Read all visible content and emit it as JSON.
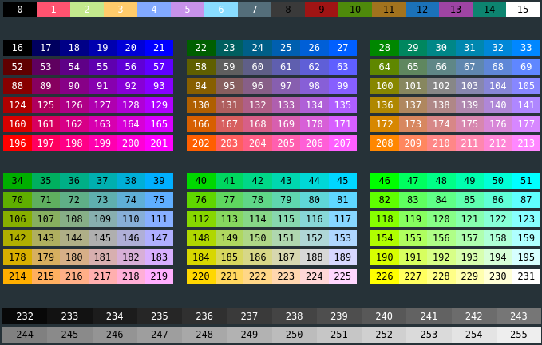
{
  "palette": {
    "base16": [
      {
        "label": "0",
        "bg": "#000000",
        "fg": "#ffffff"
      },
      {
        "label": "1",
        "bg": "#ff5370",
        "fg": "#ffffff"
      },
      {
        "label": "2",
        "bg": "#c3e88d",
        "fg": "#ffffff"
      },
      {
        "label": "3",
        "bg": "#ffcb6b",
        "fg": "#ffffff"
      },
      {
        "label": "4",
        "bg": "#82aaff",
        "fg": "#ffffff"
      },
      {
        "label": "5",
        "bg": "#c792ea",
        "fg": "#ffffff"
      },
      {
        "label": "6",
        "bg": "#89ddff",
        "fg": "#ffffff"
      },
      {
        "label": "7",
        "bg": "#546e7a",
        "fg": "#ffffff"
      },
      {
        "label": "8",
        "bg": "#3a3a3a",
        "fg": "#000000"
      },
      {
        "label": "9",
        "bg": "#a01414",
        "fg": "#000000"
      },
      {
        "label": "10",
        "bg": "#4e8a0b",
        "fg": "#000000"
      },
      {
        "label": "11",
        "bg": "#a2731e",
        "fg": "#000000"
      },
      {
        "label": "12",
        "bg": "#1b72b9",
        "fg": "#000000"
      },
      {
        "label": "13",
        "bg": "#9e44a3",
        "fg": "#000000"
      },
      {
        "label": "14",
        "bg": "#0d8470",
        "fg": "#000000"
      },
      {
        "label": "15",
        "bg": "#ffffff",
        "fg": "#000000"
      }
    ],
    "cube_levels": [
      0,
      95,
      135,
      175,
      215,
      255
    ],
    "gray_rows": [
      {
        "row": "gray-row-1",
        "labels": [
          "232",
          "233",
          "234",
          "235",
          "236",
          "237",
          "238",
          "239",
          "240",
          "241",
          "242",
          "243"
        ],
        "fg": "#ffffff"
      },
      {
        "row": "gray-row-2",
        "labels": [
          "244",
          "245",
          "246",
          "247",
          "248",
          "249",
          "250",
          "251",
          "252",
          "253",
          "254",
          "255"
        ],
        "fg": "#000000"
      }
    ],
    "cube_groups": [
      {
        "group": "cube-group-g0",
        "rows": [
          {
            "labels": [
              "16",
              "17",
              "18",
              "19",
              "20",
              "21"
            ],
            "fg": "#ffffff"
          },
          {
            "labels": [
              "52",
              "53",
              "54",
              "55",
              "56",
              "57"
            ],
            "fg": "#ffffff"
          },
          {
            "labels": [
              "88",
              "89",
              "90",
              "91",
              "92",
              "93"
            ],
            "fg": "#ffffff"
          },
          {
            "labels": [
              "124",
              "125",
              "126",
              "127",
              "128",
              "129"
            ],
            "fg": "#ffffff"
          },
          {
            "labels": [
              "160",
              "161",
              "162",
              "163",
              "164",
              "165"
            ],
            "fg": "#ffffff"
          },
          {
            "labels": [
              "196",
              "197",
              "198",
              "199",
              "200",
              "201"
            ],
            "fg": "#ffffff"
          }
        ]
      },
      {
        "group": "cube-group-g1",
        "rows": [
          {
            "labels": [
              "22",
              "23",
              "24",
              "25",
              "26",
              "27"
            ],
            "fg": "#ffffff"
          },
          {
            "labels": [
              "58",
              "59",
              "60",
              "61",
              "62",
              "63"
            ],
            "fg": "#ffffff"
          },
          {
            "labels": [
              "94",
              "95",
              "96",
              "97",
              "98",
              "99"
            ],
            "fg": "#ffffff"
          },
          {
            "labels": [
              "130",
              "131",
              "132",
              "133",
              "134",
              "135"
            ],
            "fg": "#ffffff"
          },
          {
            "labels": [
              "166",
              "167",
              "168",
              "169",
              "170",
              "171"
            ],
            "fg": "#ffffff"
          },
          {
            "labels": [
              "202",
              "203",
              "204",
              "205",
              "206",
              "207"
            ],
            "fg": "#ffffff"
          }
        ]
      },
      {
        "group": "cube-group-g2",
        "rows": [
          {
            "labels": [
              "28",
              "29",
              "30",
              "31",
              "32",
              "33"
            ],
            "fg": "#ffffff"
          },
          {
            "labels": [
              "64",
              "65",
              "66",
              "67",
              "68",
              "69"
            ],
            "fg": "#ffffff"
          },
          {
            "labels": [
              "100",
              "101",
              "102",
              "103",
              "104",
              "105"
            ],
            "fg": "#ffffff"
          },
          {
            "labels": [
              "136",
              "137",
              "138",
              "139",
              "140",
              "141"
            ],
            "fg": "#ffffff"
          },
          {
            "labels": [
              "172",
              "173",
              "174",
              "175",
              "176",
              "177"
            ],
            "fg": "#ffffff"
          },
          {
            "labels": [
              "208",
              "209",
              "210",
              "211",
              "212",
              "213"
            ],
            "fg": "#ffffff"
          }
        ]
      },
      {
        "group": "cube-group-g3",
        "rows": [
          {
            "labels": [
              "34",
              "35",
              "36",
              "37",
              "38",
              "39"
            ],
            "fg": "#000000"
          },
          {
            "labels": [
              "70",
              "71",
              "72",
              "73",
              "74",
              "75"
            ],
            "fg": "#000000"
          },
          {
            "labels": [
              "106",
              "107",
              "108",
              "109",
              "110",
              "111"
            ],
            "fg": "#000000"
          },
          {
            "labels": [
              "142",
              "143",
              "144",
              "145",
              "146",
              "147"
            ],
            "fg": "#000000"
          },
          {
            "labels": [
              "178",
              "179",
              "180",
              "181",
              "182",
              "183"
            ],
            "fg": "#000000"
          },
          {
            "labels": [
              "214",
              "215",
              "216",
              "217",
              "218",
              "219"
            ],
            "fg": "#000000"
          }
        ]
      },
      {
        "group": "cube-group-g4",
        "rows": [
          {
            "labels": [
              "40",
              "41",
              "42",
              "43",
              "44",
              "45"
            ],
            "fg": "#000000"
          },
          {
            "labels": [
              "76",
              "77",
              "78",
              "79",
              "80",
              "81"
            ],
            "fg": "#000000"
          },
          {
            "labels": [
              "112",
              "113",
              "114",
              "115",
              "116",
              "117"
            ],
            "fg": "#000000"
          },
          {
            "labels": [
              "148",
              "149",
              "150",
              "151",
              "152",
              "153"
            ],
            "fg": "#000000"
          },
          {
            "labels": [
              "184",
              "185",
              "186",
              "187",
              "188",
              "189"
            ],
            "fg": "#000000"
          },
          {
            "labels": [
              "220",
              "221",
              "222",
              "223",
              "224",
              "225"
            ],
            "fg": "#000000"
          }
        ]
      },
      {
        "group": "cube-group-g5",
        "rows": [
          {
            "labels": [
              "46",
              "47",
              "48",
              "49",
              "50",
              "51"
            ],
            "fg": "#000000"
          },
          {
            "labels": [
              "82",
              "83",
              "84",
              "85",
              "86",
              "87"
            ],
            "fg": "#000000"
          },
          {
            "labels": [
              "118",
              "119",
              "120",
              "121",
              "122",
              "123"
            ],
            "fg": "#000000"
          },
          {
            "labels": [
              "154",
              "155",
              "156",
              "157",
              "158",
              "159"
            ],
            "fg": "#000000"
          },
          {
            "labels": [
              "190",
              "191",
              "192",
              "193",
              "194",
              "195"
            ],
            "fg": "#000000"
          },
          {
            "labels": [
              "226",
              "227",
              "228",
              "229",
              "230",
              "231"
            ],
            "fg": "#000000"
          }
        ]
      }
    ]
  }
}
